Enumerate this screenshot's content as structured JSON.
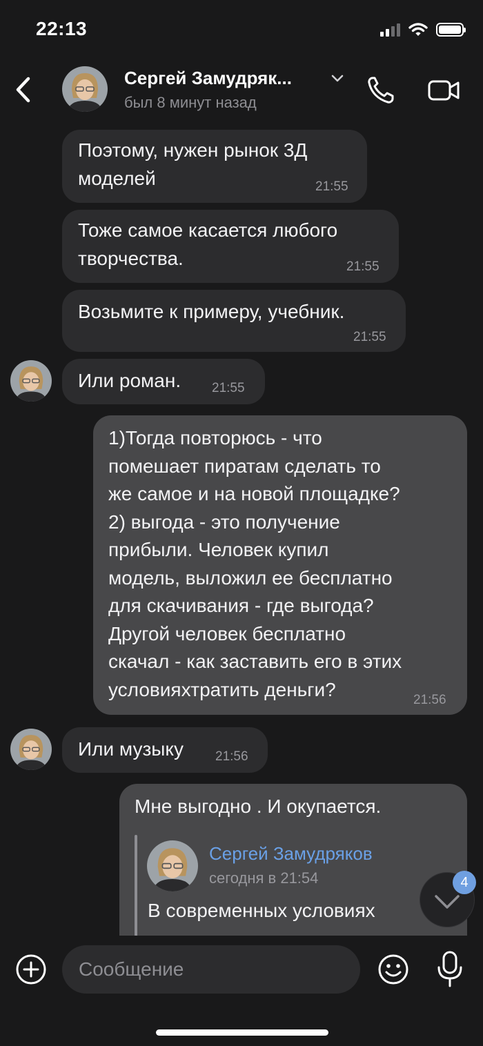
{
  "status_bar": {
    "time": "22:13"
  },
  "header": {
    "contact_name": "Сергей Замудряк...",
    "last_seen": "был 8 минут назад"
  },
  "messages": [
    {
      "direction": "in",
      "text": "Поэтому, нужен рынок 3Д\nмоделей",
      "time": "21:55"
    },
    {
      "direction": "in",
      "text": "Тоже самое касается любого\nтворчества.",
      "time": "21:55"
    },
    {
      "direction": "in",
      "text": "Возьмите к примеру, учебник.",
      "time": "21:55"
    },
    {
      "direction": "in",
      "text": "Или роман.",
      "time": "21:55"
    },
    {
      "direction": "out",
      "text": "1)Тогда повторюсь - что\nпомешает пиратам  сделать то\nже самое и на новой площадке?\n2) выгода - это получение\nприбыли.  Человек купил\nмодель, выложил  ее бесплатно\nдля скачивания - где выгода?\nДругой человек бесплатно\nскачал - как заставить его в этих\nусловияхтратить деньги?",
      "time": "21:56"
    },
    {
      "direction": "in",
      "text": "Или музыку",
      "time": "21:56"
    },
    {
      "direction": "out",
      "text": "Мне выгодно . И окупается.",
      "time": ""
    }
  ],
  "reply_preview": {
    "author": "Сергей Замудряков",
    "date": "сегодня в 21:54",
    "text": "В современных условиях"
  },
  "unread_count": "4",
  "composer": {
    "placeholder": "Сообщение"
  },
  "colors": {
    "background": "#19191a",
    "incoming_bubble": "#2c2c2e",
    "outgoing_bubble": "#48484a",
    "accent": "#6aa0e6"
  },
  "icons": [
    "back-icon",
    "chevron-down-icon",
    "phone-icon",
    "video-camera-icon",
    "chevron-down-icon",
    "plus-circle-icon",
    "smiley-icon",
    "microphone-icon"
  ]
}
